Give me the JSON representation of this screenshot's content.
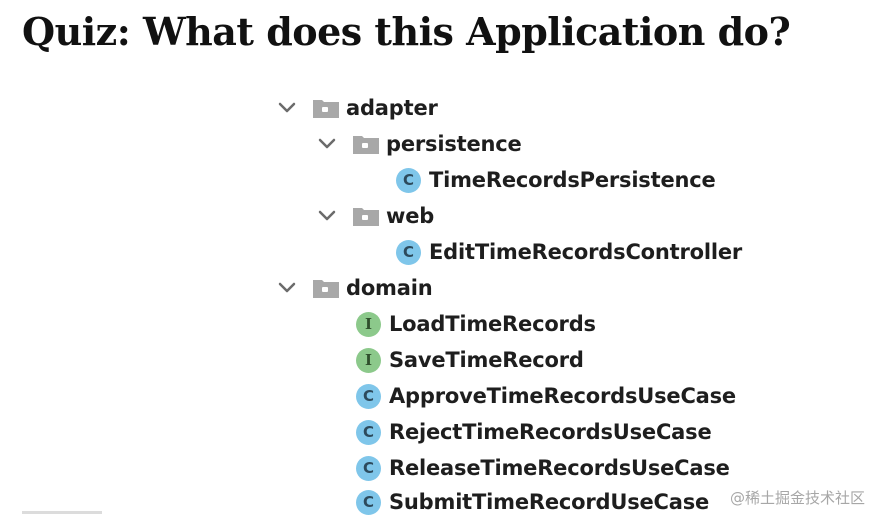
{
  "title": "Quiz: What does this Application do?",
  "colors": {
    "class_icon": "#7fc6ea",
    "interface_icon": "#8cc98b",
    "folder": "#a8a8a8",
    "chevron": "#6b6b6b"
  },
  "tree": {
    "adapter": {
      "label": "adapter",
      "persistence": {
        "label": "persistence",
        "items": [
          {
            "kind": "C",
            "label": "TimeRecordsPersistence"
          }
        ]
      },
      "web": {
        "label": "web",
        "items": [
          {
            "kind": "C",
            "label": "EditTimeRecordsController"
          }
        ]
      }
    },
    "domain": {
      "label": "domain",
      "items": [
        {
          "kind": "I",
          "label": "LoadTimeRecords"
        },
        {
          "kind": "I",
          "label": "SaveTimeRecord"
        },
        {
          "kind": "C",
          "label": "ApproveTimeRecordsUseCase"
        },
        {
          "kind": "C",
          "label": "RejectTimeRecordsUseCase"
        },
        {
          "kind": "C",
          "label": "ReleaseTimeRecordsUseCase"
        },
        {
          "kind": "C",
          "label": "SubmitTimeRecordUseCase"
        }
      ]
    }
  },
  "watermark": "@稀土掘金技术社区"
}
